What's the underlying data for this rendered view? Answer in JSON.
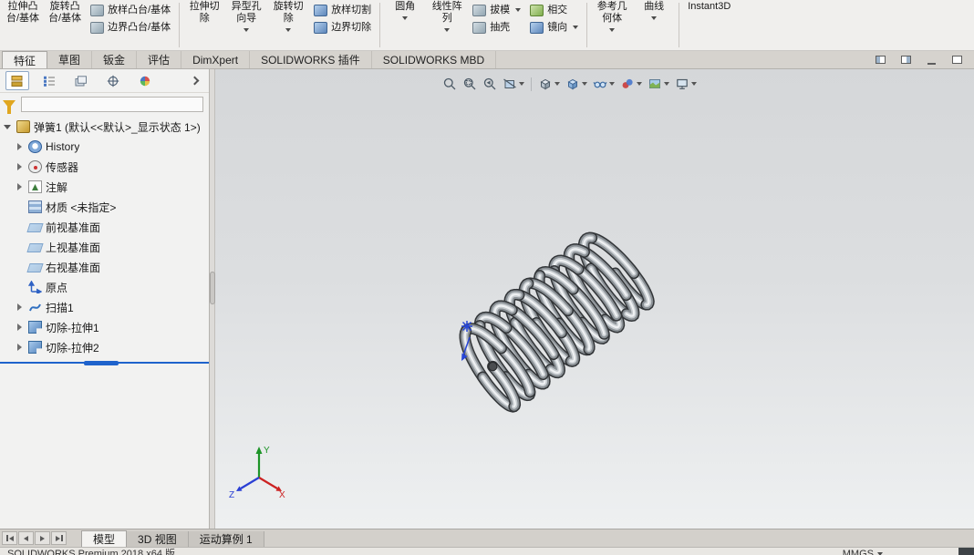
{
  "ribbon": {
    "items": [
      {
        "l1": "拉伸凸",
        "l2": "台/基体"
      },
      {
        "l1": "旋转凸",
        "l2": "台/基体"
      },
      {
        "s1": "放样凸台/基体",
        "s2": "边界凸台/基体"
      },
      {
        "l1": "拉伸切",
        "l2": "除"
      },
      {
        "l1": "异型孔",
        "l2": "向导"
      },
      {
        "l1": "旋转切",
        "l2": "除"
      },
      {
        "s1": "放样切割",
        "s2": "边界切除"
      },
      {
        "l1": "圆角",
        "l2": ""
      },
      {
        "l1": "线性阵",
        "l2": "列"
      },
      {
        "s1": "拔模",
        "s2": "抽壳"
      },
      {
        "s1": "相交",
        "s2": "镜向"
      },
      {
        "l1": "参考几",
        "l2": "何体"
      },
      {
        "l1": "曲线",
        "l2": ""
      },
      {
        "l1": "Instant3D",
        "l2": ""
      }
    ]
  },
  "tabs": {
    "items": [
      "特征",
      "草图",
      "钣金",
      "评估",
      "DimXpert",
      "SOLIDWORKS 插件",
      "SOLIDWORKS MBD"
    ]
  },
  "panel": {
    "tree": {
      "root": "弹簧1 (默认<<默认>_显示状态 1>)",
      "items": [
        {
          "label": "History"
        },
        {
          "label": "传感器"
        },
        {
          "label": "注解"
        },
        {
          "label": "材质 <未指定>"
        },
        {
          "label": "前视基准面"
        },
        {
          "label": "上视基准面"
        },
        {
          "label": "右视基准面"
        },
        {
          "label": "原点"
        },
        {
          "label": "扫描1"
        },
        {
          "label": "切除-拉伸1"
        },
        {
          "label": "切除-拉伸2"
        }
      ]
    }
  },
  "viewport": {
    "triad": {
      "x": "X",
      "y": "Y",
      "z": "Z"
    }
  },
  "bottom_tabs": {
    "items": [
      "模型",
      "3D 视图",
      "运动算例 1"
    ]
  },
  "status": {
    "left": "SOLIDWORKS Premium 2018 x64 版",
    "units": "MMGS"
  }
}
